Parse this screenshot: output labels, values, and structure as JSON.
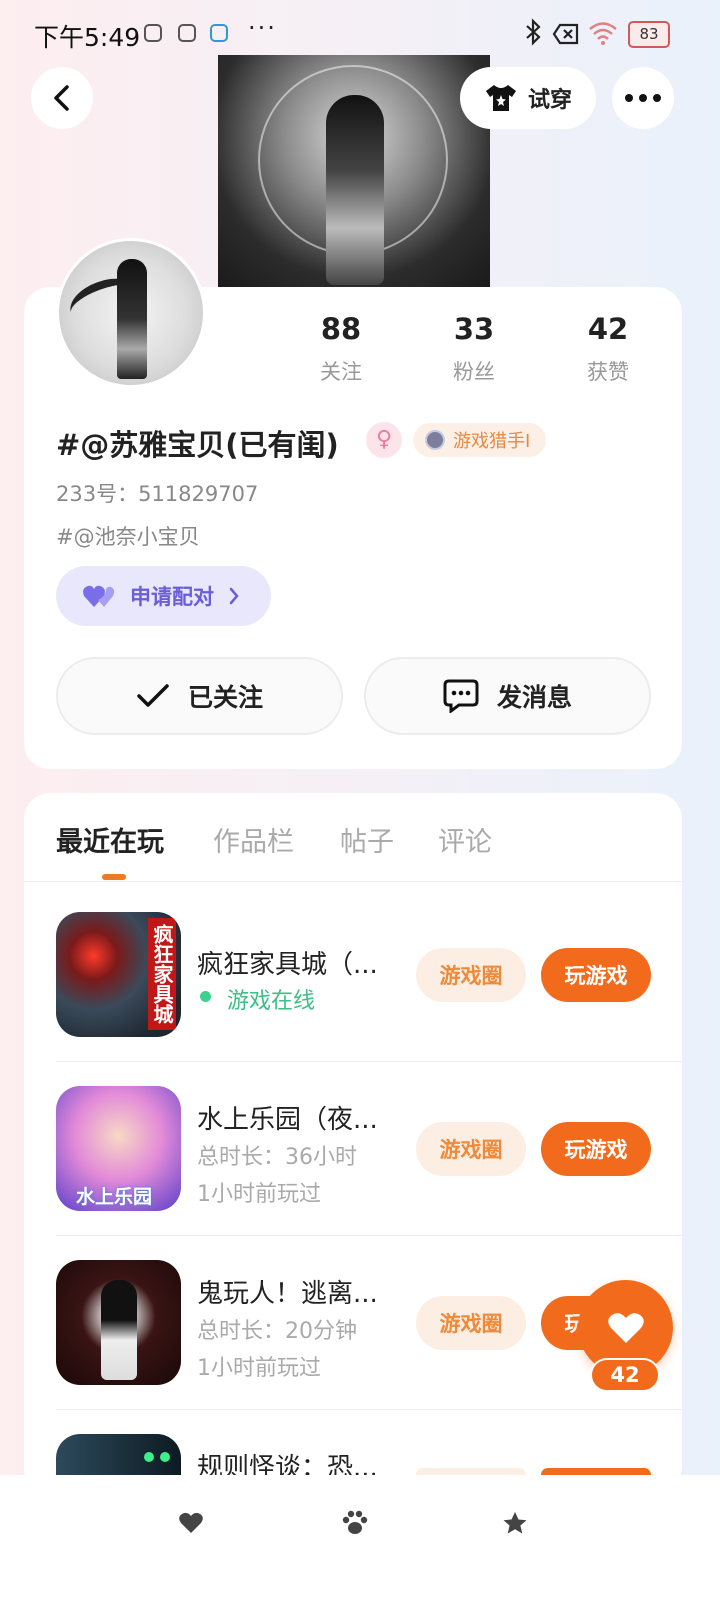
{
  "status_bar": {
    "time": "下午5:49",
    "dots": "···",
    "battery": "83"
  },
  "header": {
    "try_on_label": "试穿"
  },
  "profile": {
    "stats": [
      {
        "value": "88",
        "label": "关注"
      },
      {
        "value": "33",
        "label": "粉丝"
      },
      {
        "value": "42",
        "label": "获赞"
      }
    ],
    "nickname": "#@苏雅宝贝(已有闺)",
    "gender_symbol": "♀",
    "badge_label": "游戏猎手Ⅰ",
    "uid": "233号：511829707",
    "bio": "#@池奈小宝贝",
    "pair_label": "申请配对",
    "follow_label": "已关注",
    "message_label": "发消息"
  },
  "tabs": [
    {
      "label": "最近在玩",
      "active": true
    },
    {
      "label": "作品栏",
      "active": false
    },
    {
      "label": "帖子",
      "active": false
    },
    {
      "label": "评论",
      "active": false
    }
  ],
  "games": [
    {
      "title": "疯狂家具城（...",
      "status": "游戏在线",
      "line1": "",
      "line2": "",
      "icon_text": "疯狂家具城"
    },
    {
      "title": "水上乐园（夜...",
      "status": "",
      "line1": "总时长：36小时",
      "line2": "1小时前玩过",
      "icon_text": "水上乐园"
    },
    {
      "title": "鬼玩人！逃离...",
      "status": "",
      "line1": "总时长：20分钟",
      "line2": "1小时前玩过",
      "icon_text": ""
    },
    {
      "title": "规则怪谈：恐...",
      "status": "",
      "line1": "",
      "line2": "",
      "icon_text": ""
    }
  ],
  "game_buttons": {
    "circle_label": "游戏圈",
    "play_label": "玩游戏"
  },
  "float_like": {
    "count": "42"
  },
  "colors": {
    "accent": "#f26b1d",
    "pair": "#6a5dd8",
    "online": "#3cbf86"
  },
  "bottom_nav": {
    "icons": [
      "heart-icon",
      "paw-icon",
      "star-icon"
    ]
  }
}
